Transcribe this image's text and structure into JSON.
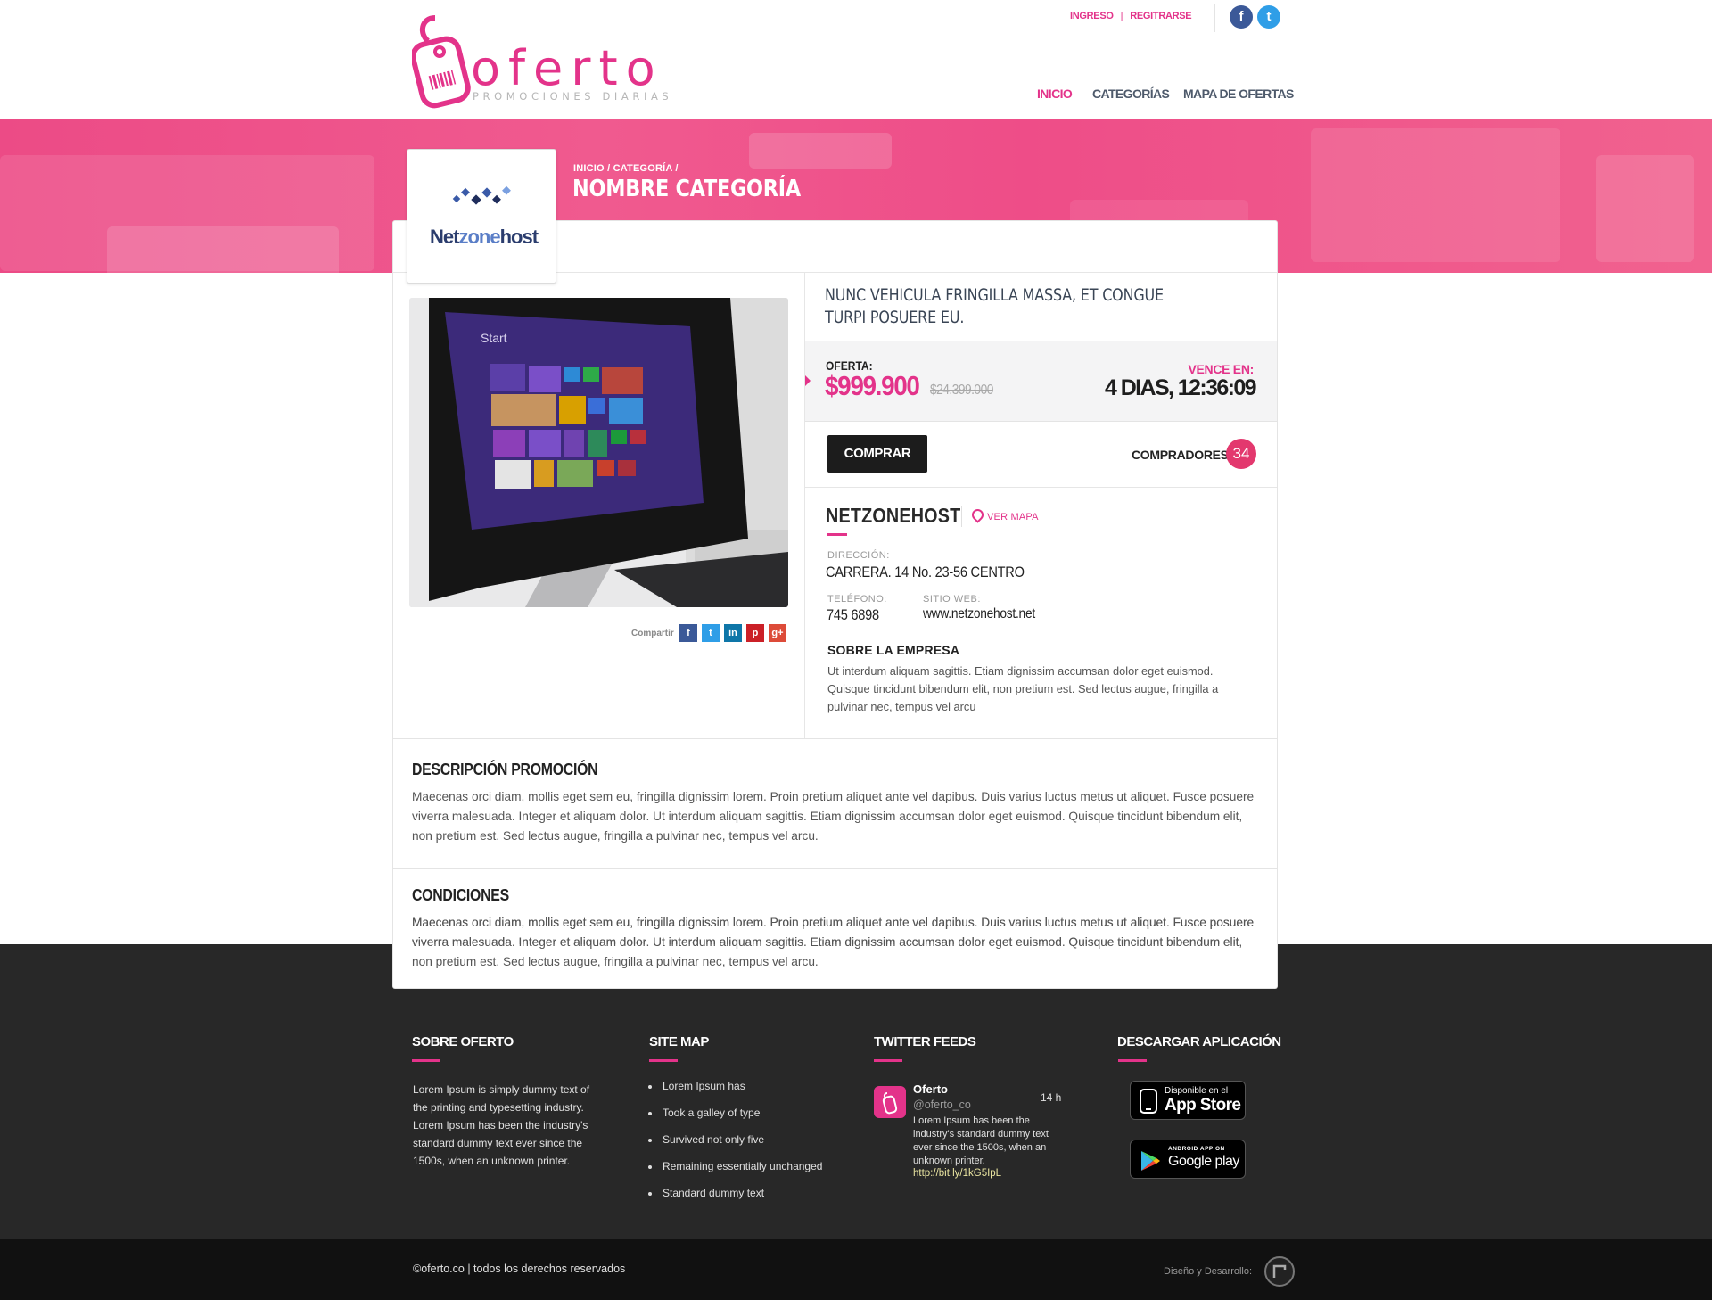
{
  "header": {
    "logo_word": "oferto",
    "logo_tagline": "PROMOCIONES DIARIAS",
    "top_links": {
      "login": "INGRESO",
      "separator": "|",
      "register": "REGITRARSE"
    },
    "social": {
      "facebook_glyph": "f",
      "twitter_glyph": "t"
    },
    "nav": [
      {
        "label": "INICIO"
      },
      {
        "label": "CATEGORÍAS"
      },
      {
        "label": "MAPA DE OFERTAS"
      }
    ],
    "brand_color": "#e3338a"
  },
  "hero": {
    "breadcrumb": "INICIO / CATEGORÍA /",
    "title": "NOMBRE CATEGORÍA"
  },
  "deal": {
    "brand_logo": {
      "part1": "Net",
      "part2": "zone",
      "part3": "host"
    },
    "title": "NUNC VEHICULA FRINGILLA MASSA, ET CONGUE TURPI POSUERE EU.",
    "offer_label": "OFERTA:",
    "price": "$999.900",
    "old_price": "$24.399.000",
    "expires_label": "VENCE EN:",
    "expires_value": "4 DIAS, 12:36:09",
    "buy_label": "COMPRAR",
    "buyers_label": "COMPRADORES:",
    "buyers_count": "34",
    "share_label": "Compartir",
    "share_icons": [
      {
        "name": "facebook-share-icon",
        "glyph": "f",
        "color": "#3b5998"
      },
      {
        "name": "twitter-share-icon",
        "glyph": "t",
        "color": "#2f9ee7"
      },
      {
        "name": "linkedin-share-icon",
        "glyph": "in",
        "color": "#0e76a8"
      },
      {
        "name": "pinterest-share-icon",
        "glyph": "p",
        "color": "#cb2027"
      },
      {
        "name": "googleplus-share-icon",
        "glyph": "g+",
        "color": "#dd4b39"
      }
    ],
    "product_screen_label": "Start"
  },
  "merchant": {
    "name": "NETZONEHOST",
    "map_link": "VER MAPA",
    "address_label": "DIRECCIÓN:",
    "address": "CARRERA. 14 No. 23-56 CENTRO",
    "phone_label": "TELÉFONO:",
    "phone": "745 6898",
    "web_label": "SITIO WEB:",
    "web": "www.netzonehost.net",
    "about_title": "SOBRE LA EMPRESA",
    "about_text": "Ut interdum aliquam sagittis. Etiam dignissim accumsan dolor eget euismod. Quisque tincidunt bibendum elit, non pretium est. Sed lectus augue, fringilla a pulvinar nec, tempus vel arcu"
  },
  "sections": {
    "description_title": "DESCRIPCIÓN PROMOCIÓN",
    "description_text": "Maecenas orci diam, mollis eget sem eu, fringilla dignissim lorem. Proin pretium aliquet ante vel dapibus. Duis varius luctus metus ut aliquet. Fusce posuere viverra malesuada. Integer et aliquam dolor. Ut interdum aliquam sagittis. Etiam dignissim accumsan dolor eget euismod. Quisque tincidunt bibendum elit, non pretium est. Sed lectus augue, fringilla a pulvinar nec, tempus vel arcu.",
    "conditions_title": "CONDICIONES",
    "conditions_text": "Maecenas orci diam, mollis eget sem eu, fringilla dignissim lorem. Proin pretium aliquet ante vel dapibus. Duis varius luctus metus ut aliquet. Fusce posuere viverra malesuada. Integer et aliquam dolor. Ut interdum aliquam sagittis. Etiam dignissim accumsan dolor eget euismod. Quisque tincidunt bibendum elit, non pretium est. Sed lectus augue, fringilla a pulvinar nec, tempus vel arcu."
  },
  "footer": {
    "about_title": "SOBRE OFERTO",
    "about_text": "Lorem Ipsum is simply dummy text of the printing and typesetting industry. Lorem Ipsum has been the industry's standard dummy text ever since the 1500s, when an unknown printer.",
    "sitemap_title": "SITE MAP",
    "sitemap_items": [
      "Lorem Ipsum has",
      "Took a galley of type",
      "Survived not only five",
      "Remaining essentially unchanged",
      "Standard dummy text"
    ],
    "twitter_title": "TWITTER FEEDS",
    "tweet": {
      "name": "Oferto",
      "handle": "@oferto_co",
      "time": "14 h",
      "text": "Lorem Ipsum has been the industry's standard dummy text ever since the 1500s, when an unknown printer.",
      "link": "http://bit.ly/1kG5IpL"
    },
    "app_title": "DESCARGAR APLICACIÓN",
    "appstore": {
      "small": "Disponible en el",
      "big": "App Store"
    },
    "googleplay": {
      "small": "ANDROID APP ON",
      "big": "Google play"
    },
    "copyright": "©oferto.co | todos los derechos reservados",
    "credit": "Diseño y Desarrollo:"
  }
}
